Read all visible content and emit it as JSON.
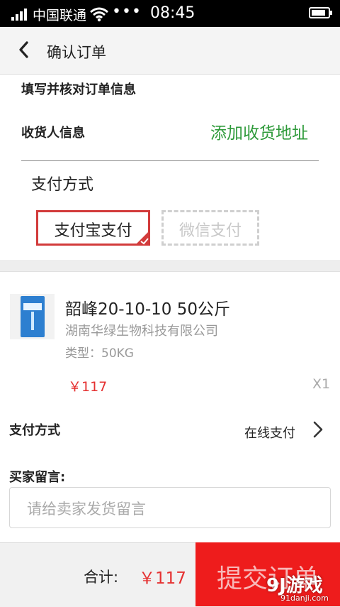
{
  "status_bar": {
    "carrier": "中国联通",
    "more": "•••",
    "time": "08:45",
    "battery_level": 0.85
  },
  "header": {
    "back_icon": "chevron-left-icon",
    "title": "确认订单"
  },
  "form": {
    "section_title": "填写并核对订单信息",
    "receiver_label": "收货人信息",
    "add_address": "添加收货地址",
    "payment_title": "支付方式",
    "payment_options": [
      {
        "label": "支付宝支付",
        "selected": true
      },
      {
        "label": "微信支付",
        "selected": false
      }
    ]
  },
  "product": {
    "name": "韶峰20-10-10 50公斤",
    "company": "湖南华绿生物科技有限公司",
    "type": "类型：50KG",
    "price": "￥117",
    "quantity": "X1"
  },
  "payment_method": {
    "label": "支付方式",
    "value": "在线支付"
  },
  "message": {
    "label": "买家留言:",
    "placeholder": "请给卖家发货留言"
  },
  "footer": {
    "total_label": "合计:",
    "total_value": "￥117",
    "submit_label": "提交订单"
  },
  "watermark": {
    "logo": "9J游戏",
    "url": "91danji.com"
  },
  "colors": {
    "accent_red": "#e53131",
    "submit_red": "#ee1c1c",
    "green": "#2e9a3a"
  }
}
